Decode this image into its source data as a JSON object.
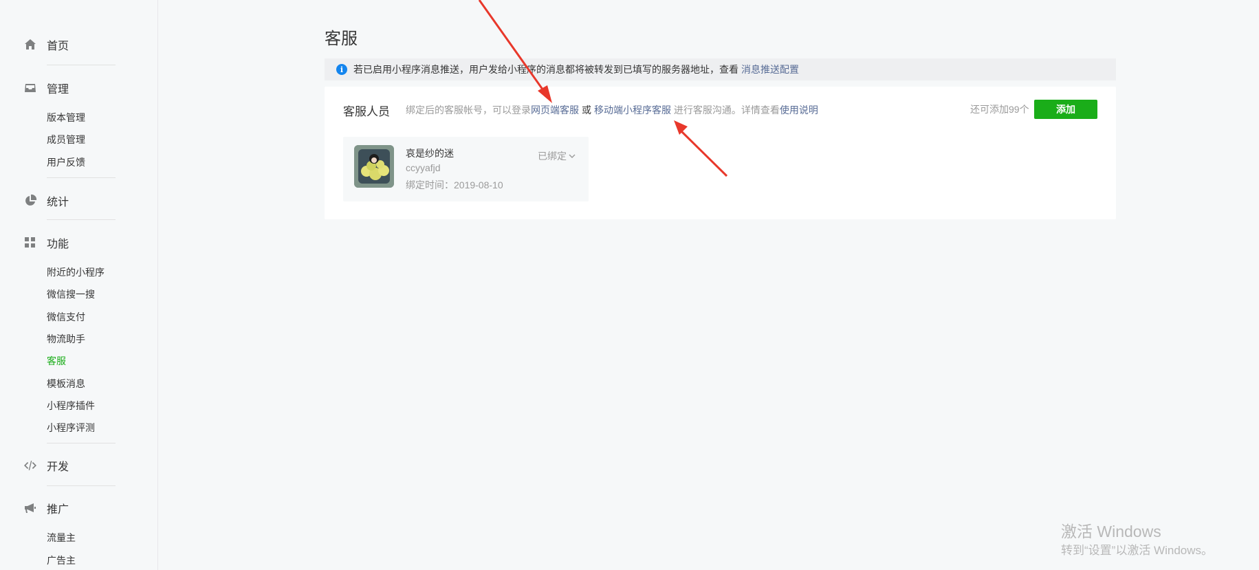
{
  "sidebar": {
    "sections": [
      {
        "label": "首页",
        "icon": "home-icon",
        "items": []
      },
      {
        "label": "管理",
        "icon": "inbox-icon",
        "items": [
          "版本管理",
          "成员管理",
          "用户反馈"
        ]
      },
      {
        "label": "统计",
        "icon": "pie-chart-icon",
        "items": []
      },
      {
        "label": "功能",
        "icon": "grid-icon",
        "items": [
          "附近的小程序",
          "微信搜一搜",
          "微信支付",
          "物流助手",
          "客服",
          "模板消息",
          "小程序插件",
          "小程序评测"
        ]
      },
      {
        "label": "开发",
        "icon": "code-icon",
        "items": []
      },
      {
        "label": "推广",
        "icon": "megaphone-icon",
        "items": [
          "流量主",
          "广告主"
        ]
      }
    ],
    "active_item": "客服"
  },
  "page": {
    "title": "客服"
  },
  "notice": {
    "text": "若已启用小程序消息推送，用户发给小程序的消息都将被转发到已填写的服务器地址，查看",
    "link": "消息推送配置"
  },
  "card": {
    "title": "客服人员",
    "desc_prefix": "绑定后的客服帐号，可以登录",
    "link_web": "网页端客服",
    "desc_or": "或",
    "link_mobile": "移动端小程序客服",
    "desc_middle": "进行客服沟通。详情查看",
    "link_help": "使用说明",
    "remaining": "还可添加99个",
    "add_label": "添加"
  },
  "agent": {
    "name": "哀是纱的迷",
    "account": "ccyyafjd",
    "bind_time": "绑定时间：2019-08-10",
    "status": "已绑定"
  },
  "watermark": {
    "line1": "激活 Windows",
    "line2": "转到“设置”以激活 Windows。"
  },
  "colors": {
    "accent_green": "#1aad19",
    "link_blue": "#576b95",
    "info_blue": "#1485ee",
    "annotation_red": "#e8382b"
  }
}
